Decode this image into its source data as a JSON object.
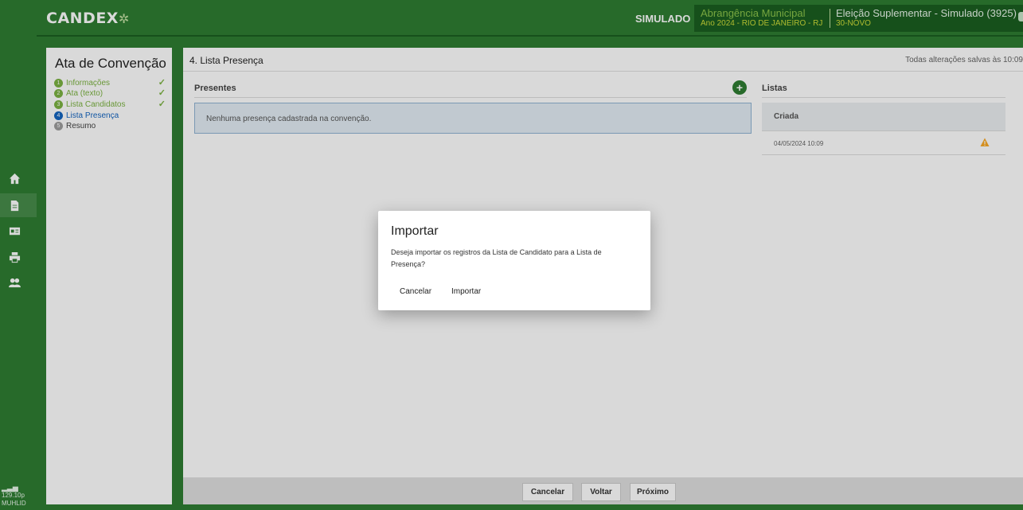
{
  "app": {
    "logo": "CANDEX",
    "mode_badge": "SIMULADO",
    "scope_title": "Abrangência Municipal",
    "scope_detail": "Ano 2024 - RIO DE JANEIRO - RJ",
    "election_title": "Eleição Suplementar - Simulado (3925)",
    "election_detail": "30-NOVO"
  },
  "rail": {
    "status_line1": "129.10p",
    "status_line2": "MUHLID"
  },
  "steps_panel": {
    "title": "Ata de Convenção",
    "steps": [
      {
        "number": "1",
        "label": "Informações",
        "state": "done"
      },
      {
        "number": "2",
        "label": "Ata (texto)",
        "state": "done"
      },
      {
        "number": "3",
        "label": "Lista Candidatos",
        "state": "done"
      },
      {
        "number": "4",
        "label": "Lista Presença",
        "state": "current"
      },
      {
        "number": "5",
        "label": "Resumo",
        "state": "pending"
      }
    ]
  },
  "main": {
    "title": "4. Lista Presença",
    "saved_status": "Todas alterações salvas às 10:09",
    "presentes_title": "Presentes",
    "empty_message": "Nenhuma presença cadastrada na convenção.",
    "listas_title": "Listas",
    "listas_column": "Criada",
    "listas_rows": [
      {
        "created": "04/05/2024 10:09"
      }
    ]
  },
  "footer": {
    "cancel_label": "Cancelar",
    "back_label": "Voltar",
    "next_label": "Próximo"
  },
  "modal": {
    "title": "Importar",
    "body": "Deseja importar os registros da Lista de Candidato para a Lista de Presença?",
    "cancel_label": "Cancelar",
    "confirm_label": "Importar"
  },
  "colors": {
    "brand_green": "#2e7d32",
    "done_green": "#7cb342",
    "current_blue": "#1565c0",
    "warning_orange": "#f9a825"
  }
}
